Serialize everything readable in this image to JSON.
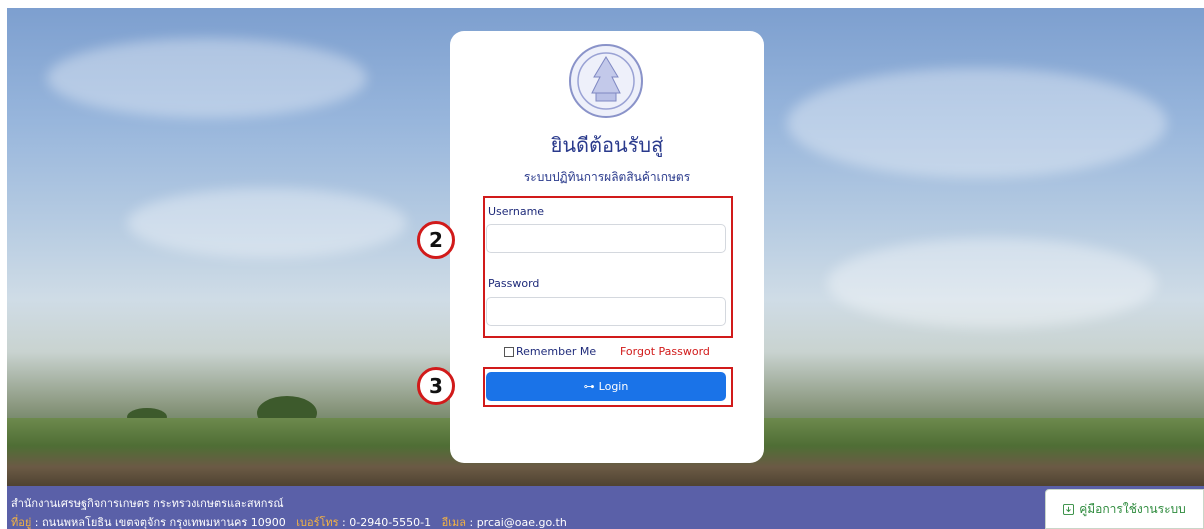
{
  "login": {
    "welcome": "ยินดีต้อนรับสู่",
    "subtitle": "ระบบปฏิทินการผลิตสินค้าเกษตร",
    "username_label": "Username",
    "password_label": "Password",
    "remember_label": "Remember Me",
    "forgot_label": "Forgot Password",
    "login_label": "Login",
    "login_icon_glyph": "⊶"
  },
  "annotations": {
    "step_2": "2",
    "step_3": "3"
  },
  "footer": {
    "org_name": "สำนักงานเศรษฐกิจการเกษตร กระทรวงเกษตรและสหกรณ์",
    "address_label": "ที่อยู่",
    "address_value": " : ถนนพหลโยธิน เขตจตุจักร กรุงเทพมหานคร 10900",
    "phone_label": "เบอร์โทร",
    "phone_value": " : 0-2940-5550-1",
    "email_label": "อีเมล",
    "email_value": " : prcai@oae.go.th",
    "manual_label": "คู่มือการใช้งานระบบ"
  },
  "colors": {
    "brand_navy": "#2a3a8c",
    "login_button": "#1a73e8",
    "annotation_red": "#d11a1a",
    "footer_bg": "#5a60a8",
    "footer_label": "#f5b342",
    "manual_green": "#2e8b3d"
  },
  "icons": [
    "emblem-logo",
    "key-icon",
    "download-icon",
    "checkbox"
  ]
}
